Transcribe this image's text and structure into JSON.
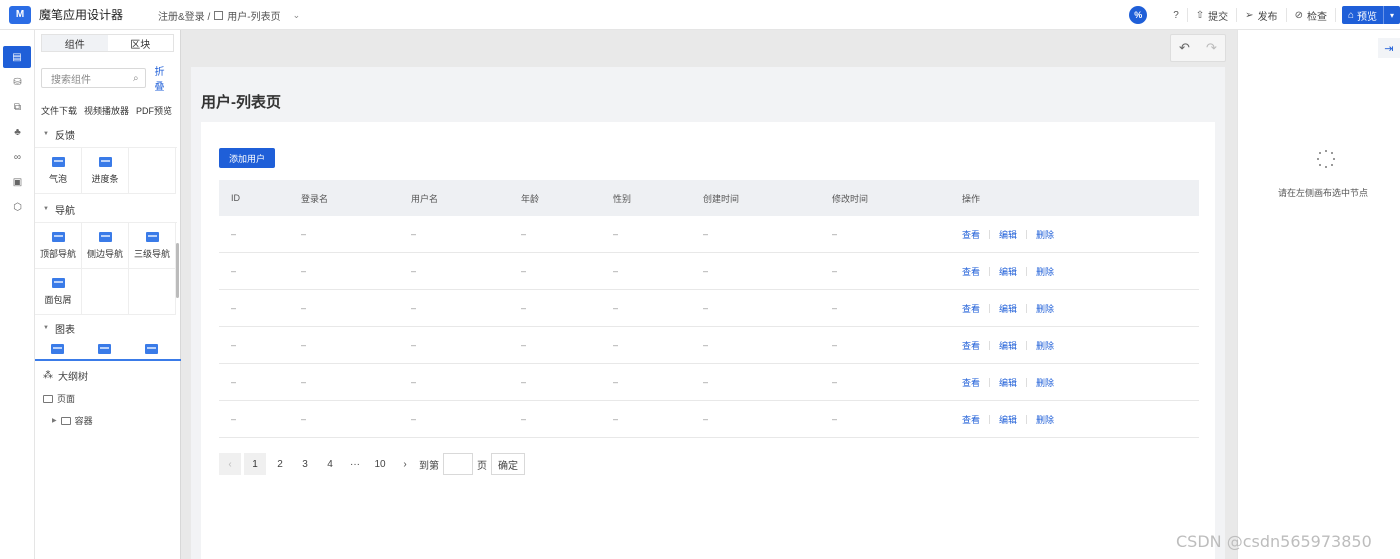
{
  "app": {
    "logo": "M",
    "title": "魔笔应用设计器"
  },
  "breadcrumb": {
    "parent": "注册&登录 /",
    "page": "用户-列表页"
  },
  "toolbar": {
    "percent_label": "%",
    "help_icon": "question-circle-icon",
    "submit_label": "提交",
    "publish_label": "发布",
    "check_label": "检查",
    "preview_label": "预览"
  },
  "rail": {
    "items": [
      "page-icon",
      "database-icon",
      "flow-icon",
      "org-icon",
      "link-icon",
      "package-icon",
      "cube-icon"
    ]
  },
  "panel": {
    "tabs": [
      "组件",
      "区块"
    ],
    "search_placeholder": "搜索组件",
    "collapse_label": "折叠",
    "quick_items": [
      "文件下载",
      "视频播放器",
      "PDF预览"
    ],
    "groups": [
      {
        "title": "反馈",
        "items": [
          "气泡",
          "进度条"
        ]
      },
      {
        "title": "导航",
        "items": [
          "顶部导航",
          "侧边导航",
          "三级导航",
          "面包屑"
        ]
      },
      {
        "title": "图表",
        "items": []
      }
    ],
    "tree_title": "大纲树",
    "tree_page": "页面",
    "tree_container": "容器"
  },
  "canvas": {
    "page_title": "用户-列表页",
    "add_button": "添加用户",
    "columns": [
      "ID",
      "登录名",
      "用户名",
      "年龄",
      "性别",
      "创建时间",
      "修改时间",
      "操作"
    ],
    "rows": [
      [
        "–",
        "–",
        "–",
        "–",
        "–",
        "–",
        "–"
      ],
      [
        "–",
        "–",
        "–",
        "–",
        "–",
        "–",
        "–"
      ],
      [
        "–",
        "–",
        "–",
        "–",
        "–",
        "–",
        "–"
      ],
      [
        "–",
        "–",
        "–",
        "–",
        "–",
        "–",
        "–"
      ],
      [
        "–",
        "–",
        "–",
        "–",
        "–",
        "–",
        "–"
      ],
      [
        "–",
        "–",
        "–",
        "–",
        "–",
        "–",
        "–"
      ]
    ],
    "ops": [
      "查看",
      "编辑",
      "删除"
    ],
    "pager": {
      "prev": "‹",
      "pages": [
        "1",
        "2",
        "3",
        "4",
        "···",
        "10"
      ],
      "current": "1",
      "next": "›",
      "goto_prefix": "到第",
      "goto_suffix": "页",
      "confirm": "确定"
    }
  },
  "right_panel": {
    "empty_text": "请在左侧画布选中节点"
  },
  "watermark": "CSDN @csdn565973850",
  "colors": {
    "accent": "#1f5fd8",
    "canvas_bg": "#e9e9e9"
  }
}
